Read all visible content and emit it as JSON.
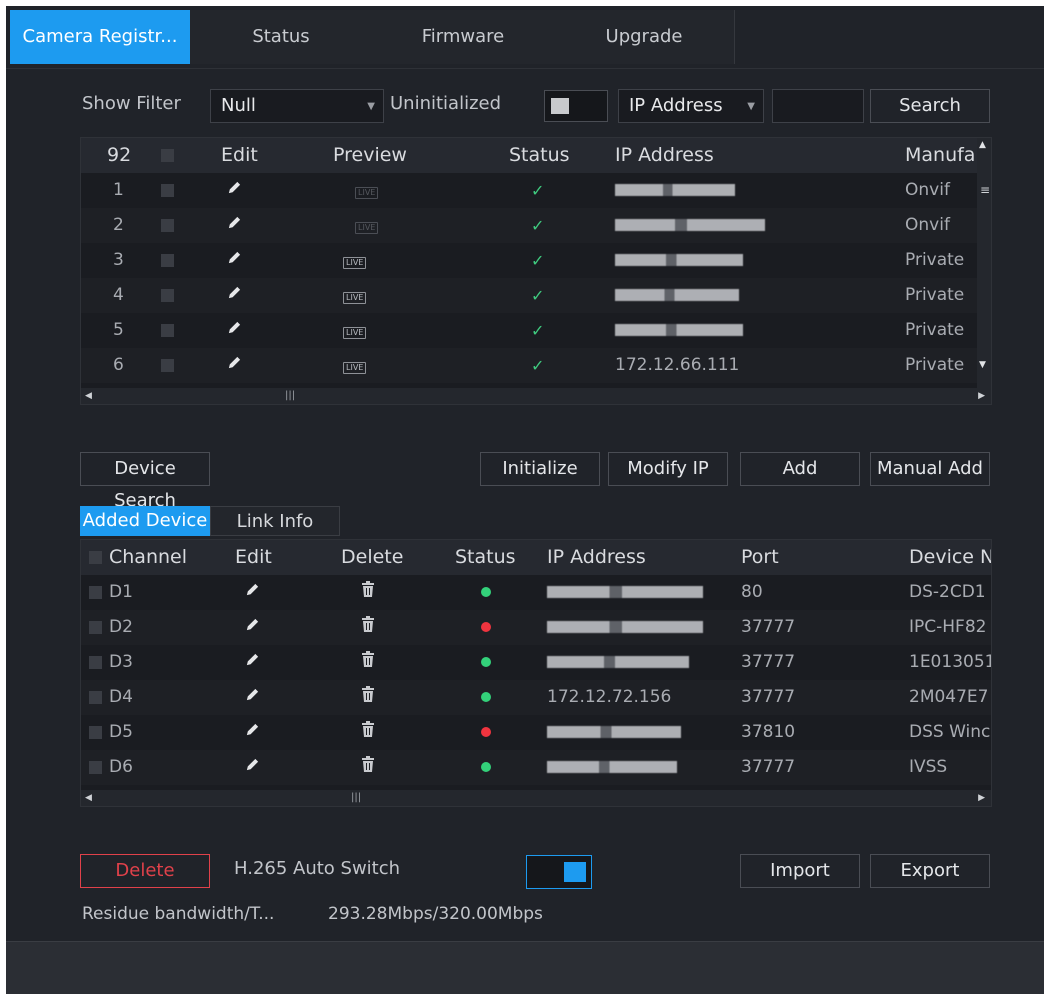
{
  "tabs": [
    {
      "label": "Camera Registr...",
      "active": true
    },
    {
      "label": "Status",
      "active": false
    },
    {
      "label": "Firmware",
      "active": false
    },
    {
      "label": "Upgrade",
      "active": false
    }
  ],
  "filter": {
    "show_filter_label": "Show Filter",
    "filter_value": "Null",
    "uninitialized_label": "Uninitialized",
    "search_type": "IP Address",
    "search_value": "",
    "search_button": "Search"
  },
  "search_table": {
    "count": "92",
    "headers": {
      "edit": "Edit",
      "preview": "Preview",
      "status": "Status",
      "ip": "IP Address",
      "manufacturer": "Manufa"
    },
    "rows": [
      {
        "no": "1",
        "preview": "LIVE",
        "manufacturer": "Onvif"
      },
      {
        "no": "2",
        "preview": "LIVE",
        "manufacturer": "Onvif"
      },
      {
        "no": "3",
        "preview": "LIVE",
        "manufacturer": "Private"
      },
      {
        "no": "4",
        "preview": "LIVE",
        "manufacturer": "Private"
      },
      {
        "no": "5",
        "preview": "LIVE",
        "manufacturer": "Private"
      },
      {
        "no": "6",
        "preview": "LIVE",
        "manufacturer": "Private",
        "ip": "172.12.66.111"
      }
    ]
  },
  "actions": {
    "device_search": "Device Search",
    "initialize": "Initialize",
    "modify_ip": "Modify IP",
    "add": "Add",
    "manual_add": "Manual Add"
  },
  "subtabs": [
    {
      "label": "Added Device",
      "active": true
    },
    {
      "label": "Link Info",
      "active": false
    }
  ],
  "added_table": {
    "headers": {
      "channel": "Channel",
      "edit": "Edit",
      "delete": "Delete",
      "status": "Status",
      "ip": "IP Address",
      "port": "Port",
      "device_name": "Device N"
    },
    "rows": [
      {
        "channel": "D1",
        "status_color": "#33d17a",
        "port": "80",
        "device_name": "DS-2CD1"
      },
      {
        "channel": "D2",
        "status_color": "#f0343f",
        "port": "37777",
        "device_name": "IPC-HF82"
      },
      {
        "channel": "D3",
        "status_color": "#33d17a",
        "port": "37777",
        "device_name": "1E013051"
      },
      {
        "channel": "D4",
        "status_color": "#33d17a",
        "port": "37777",
        "device_name": "2M047E7",
        "ip": "172.12.72.156"
      },
      {
        "channel": "D5",
        "status_color": "#f0343f",
        "port": "37810",
        "device_name": "DSS Winc"
      },
      {
        "channel": "D6",
        "status_color": "#33d17a",
        "port": "37777",
        "device_name": "IVSS"
      }
    ]
  },
  "bottom": {
    "delete_button": "Delete",
    "h265_label": "H.265 Auto Switch",
    "import_button": "Import",
    "export_button": "Export",
    "bandwidth_label": "Residue bandwidth/T...",
    "bandwidth_value": "293.28Mbps/320.00Mbps"
  },
  "colors": {
    "accent": "#1d9bf0",
    "online": "#33d17a",
    "offline": "#f0343f",
    "delete": "#e0414a"
  },
  "icons": [
    "pencil-icon",
    "trash-icon",
    "check-icon",
    "live-preview-icon",
    "dropdown-caret-icon",
    "scroll-left-icon",
    "scroll-right-icon"
  ]
}
